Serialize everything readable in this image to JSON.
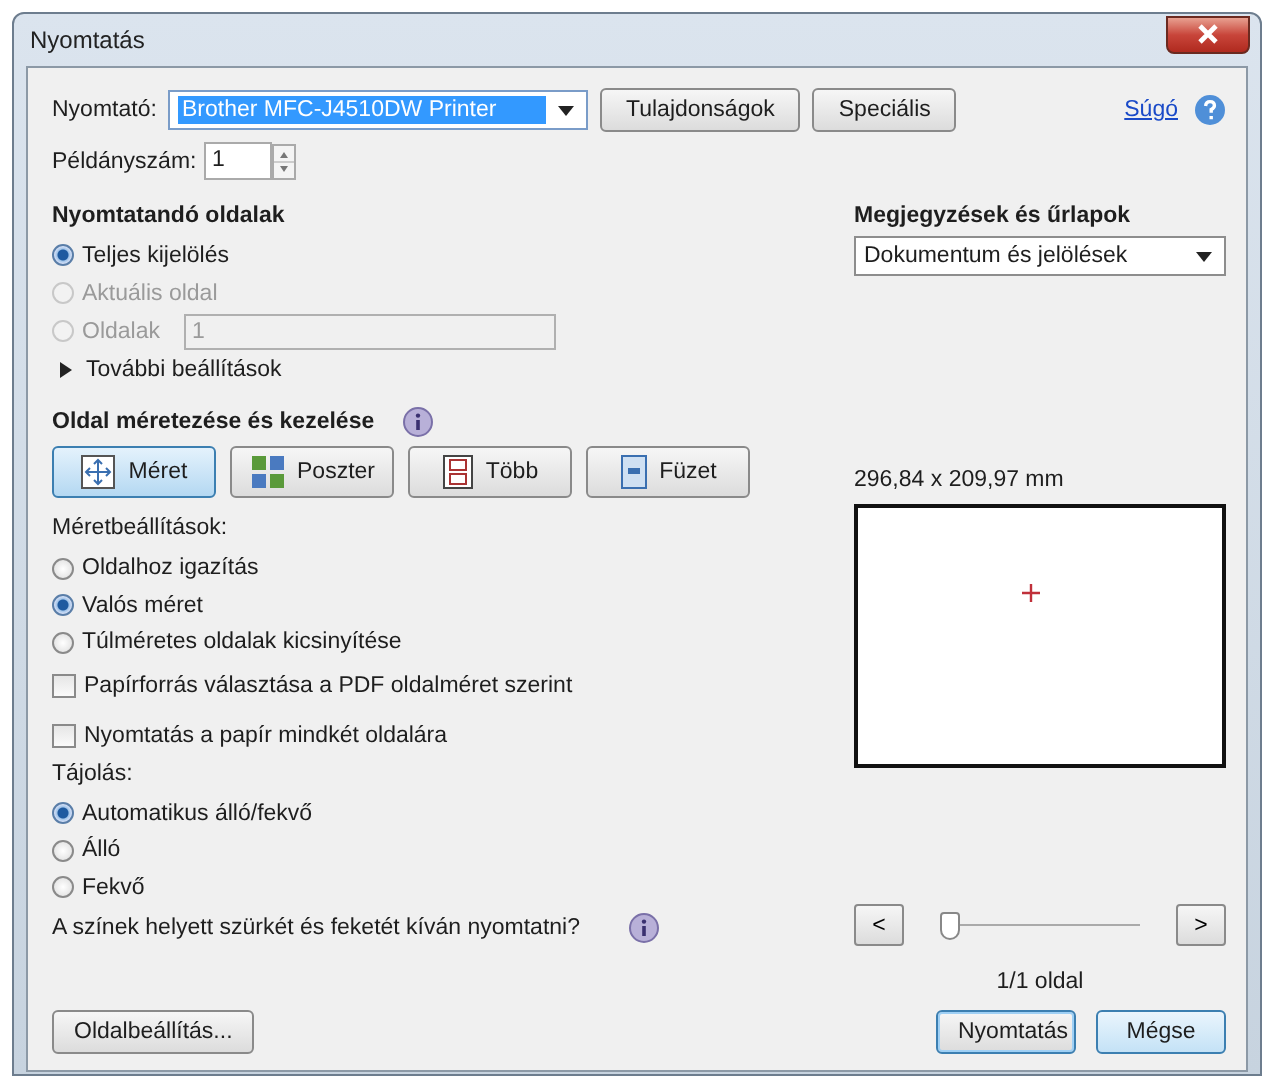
{
  "window": {
    "title": "Nyomtatás"
  },
  "printer": {
    "label": "Nyomtató:",
    "value": "Brother MFC-J4510DW Printer",
    "buttons": [
      "Tulajdonságok",
      "Speciális"
    ],
    "help_link": "Súgó"
  },
  "copies": {
    "label": "Példányszám:",
    "value": "1"
  },
  "pages_to_print": {
    "heading": "Nyomtatandó oldalak",
    "options": [
      {
        "label": "Teljes kijelölés",
        "selected": true,
        "disabled": false
      },
      {
        "label": "Aktuális oldal",
        "selected": false,
        "disabled": true
      },
      {
        "label": "Oldalak",
        "selected": false,
        "disabled": true,
        "field_value": "1"
      }
    ],
    "more_options": "További beállítások"
  },
  "sizing": {
    "heading": "Oldal méretezése és kezelése",
    "modes": [
      {
        "label": "Méret",
        "kind": "size",
        "selected": true
      },
      {
        "label": "Poszter",
        "kind": "poster",
        "selected": false
      },
      {
        "label": "Több",
        "kind": "multiple",
        "selected": false
      },
      {
        "label": "Füzet",
        "kind": "booklet",
        "selected": false
      }
    ],
    "subheading": "Méretbeállítások:",
    "options": [
      {
        "label": "Oldalhoz igazítás",
        "selected": false
      },
      {
        "label": "Valós méret",
        "selected": true
      },
      {
        "label": "Túlméretes oldalak kicsinyítése",
        "selected": false
      }
    ]
  },
  "checkboxes": [
    {
      "label": "Papírforrás választása a PDF oldalméret szerint",
      "checked": false
    },
    {
      "label": "Nyomtatás a papír mindkét oldalára",
      "checked": false
    }
  ],
  "orientation": {
    "heading": "Tájolás:",
    "options": [
      {
        "label": "Automatikus álló/fekvő",
        "selected": true
      },
      {
        "label": "Álló",
        "selected": false
      },
      {
        "label": "Fekvő",
        "selected": false
      }
    ]
  },
  "grayscale_question": "A színek helyett szürkét és feketét kíván nyomtatni?",
  "comments": {
    "heading": "Megjegyzések és űrlapok",
    "value": "Dokumentum és jelölések"
  },
  "preview": {
    "dimensions": "296,84 x 209,97 mm",
    "prev": "<",
    "next": ">",
    "page_slider": {
      "level": 0
    },
    "page_label": "1/1 oldal"
  },
  "footer": {
    "setup_button": "Oldalbeállítás...",
    "print_button": "Nyomtatás",
    "cancel_button": "Mégse"
  }
}
